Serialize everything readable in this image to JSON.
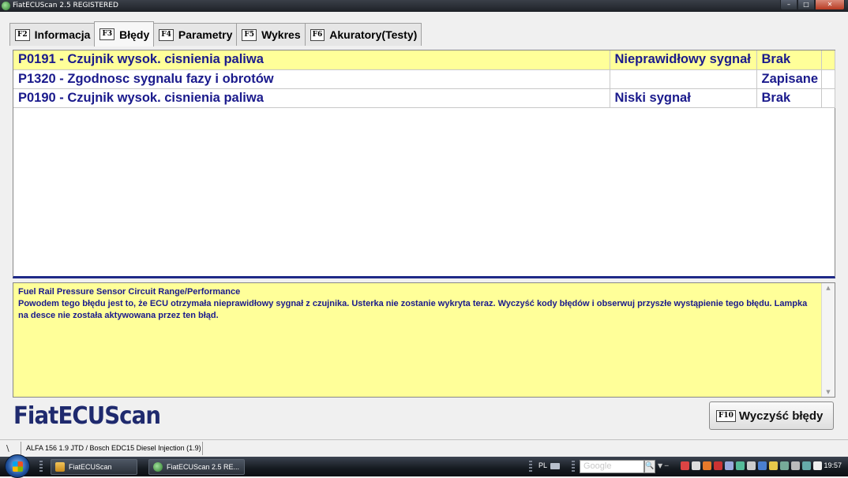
{
  "window": {
    "title": "FiatECUScan 2.5 REGISTERED",
    "controls": {
      "minimize": "–",
      "maximize": "□",
      "close": "✕"
    }
  },
  "tabs": [
    {
      "key": "F2",
      "label": "Informacja",
      "active": false
    },
    {
      "key": "F3",
      "label": "Błędy",
      "active": true
    },
    {
      "key": "F4",
      "label": "Parametry",
      "active": false
    },
    {
      "key": "F5",
      "label": "Wykres",
      "active": false
    },
    {
      "key": "F6",
      "label": "Akuratory(Testy)",
      "active": false
    }
  ],
  "errors": [
    {
      "code": "P0191 - Czujnik wysok. cisnienia paliwa",
      "condition": "Nieprawidłowy sygnał",
      "status": "Brak",
      "selected": true
    },
    {
      "code": "P1320 - Zgodnosc sygnalu fazy i obrotów",
      "condition": "",
      "status": "Zapisane",
      "selected": false
    },
    {
      "code": "P0190 - Czujnik wysok. cisnienia paliwa",
      "condition": "Niski sygnał",
      "status": "Brak",
      "selected": false
    }
  ],
  "description": {
    "title": "Fuel Rail Pressure Sensor Circuit Range/Performance",
    "body": "Powodem tego błędu jest to, że ECU otrzymała nieprawidłowy sygnał z czujnika. Usterka nie zostanie wykryta teraz. Wyczyść kody błędów i obserwuj przyszłe wystąpienie tego błędu. Lampka na desce nie została aktywowana przez ten błąd."
  },
  "logo": "FiatECUScan",
  "clear_button": {
    "key": "F10",
    "label": "Wyczyść błędy"
  },
  "statusbar": {
    "grip": "\\",
    "vehicle": "ALFA 156 1.9 JTD / Bosch EDC15 Diesel Injection (1.9)"
  },
  "taskbar": {
    "buttons": [
      "FiatECUScan",
      "FiatECUScan 2.5 RE..."
    ],
    "language": "PL",
    "search_placeholder": "Google",
    "search_button": "🔍",
    "clock": "19:57"
  },
  "colors": {
    "selected_row": "#ffff99",
    "error_text": "#1a1a8c",
    "logo": "#1f2a6e"
  }
}
